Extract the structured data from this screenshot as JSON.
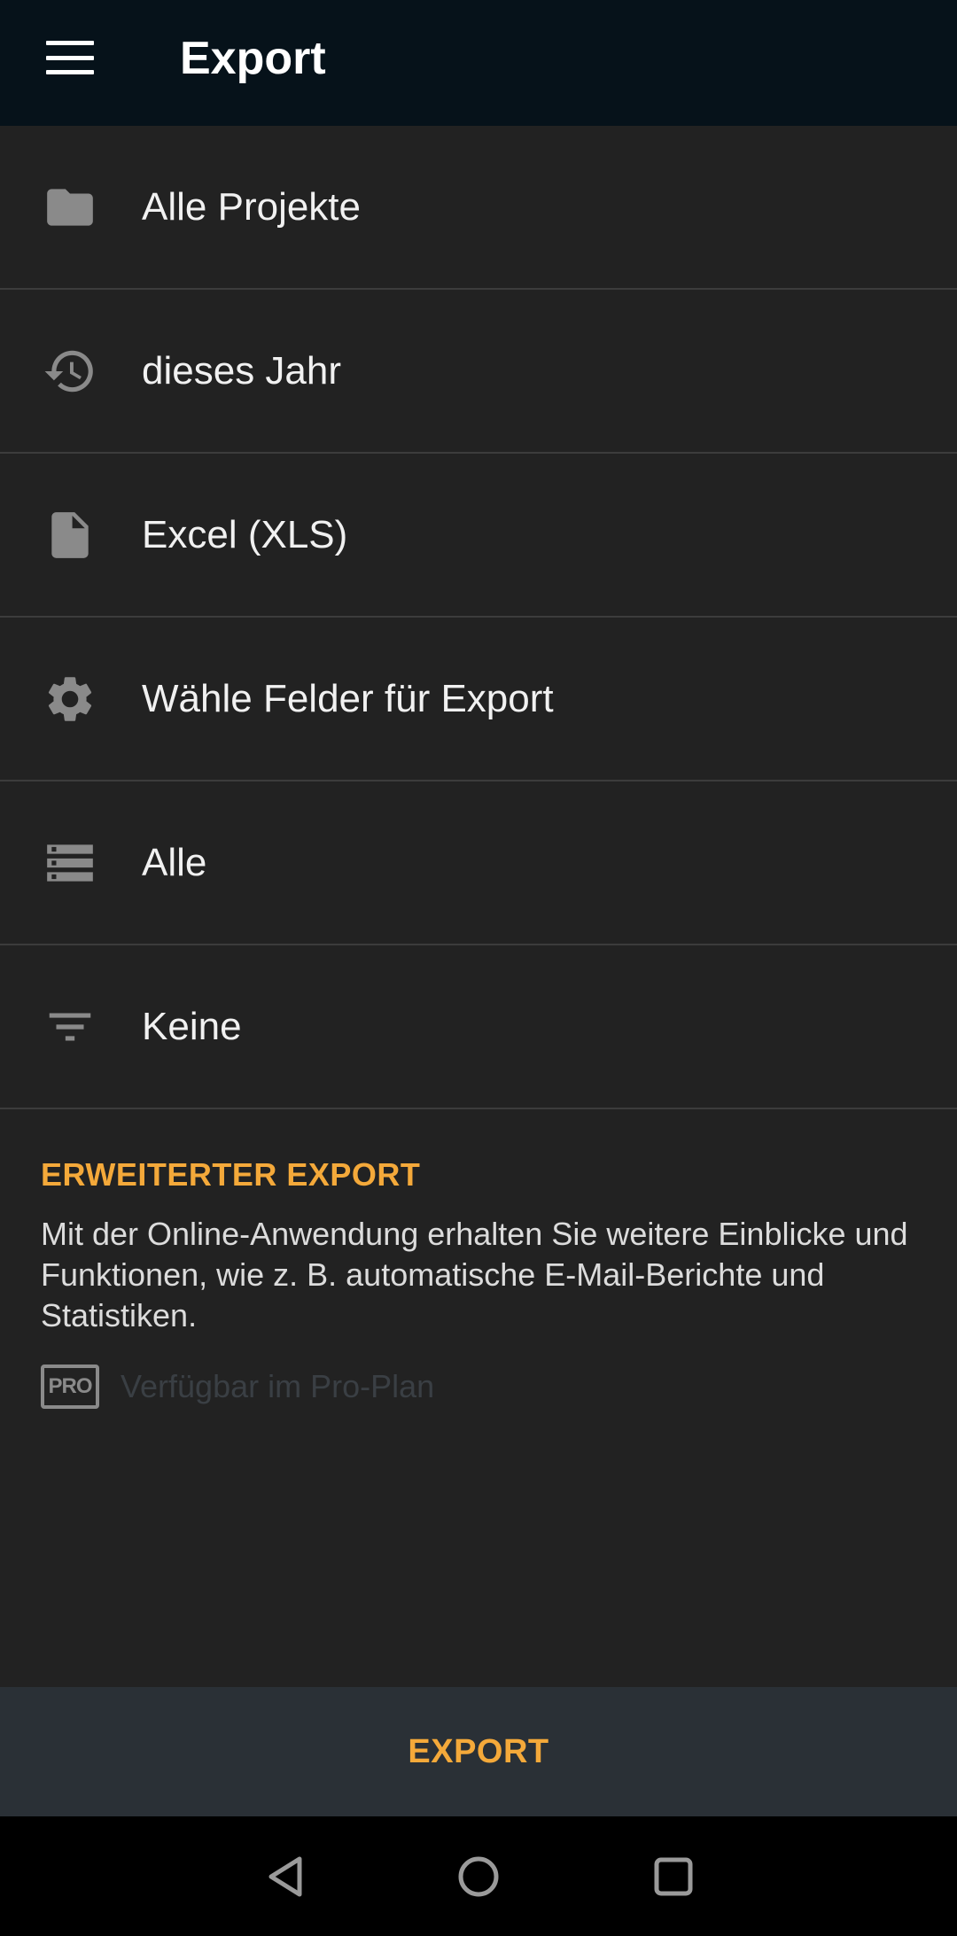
{
  "app_bar": {
    "title": "Export",
    "menu_icon": "hamburger-menu-icon"
  },
  "options": [
    {
      "icon": "folder-icon",
      "label": "Alle Projekte"
    },
    {
      "icon": "history-icon",
      "label": "dieses Jahr"
    },
    {
      "icon": "file-icon",
      "label": "Excel (XLS)"
    },
    {
      "icon": "gear-icon",
      "label": "Wähle Felder für Export"
    },
    {
      "icon": "storage-icon",
      "label": "Alle"
    },
    {
      "icon": "filter-icon",
      "label": "Keine"
    }
  ],
  "extended_export": {
    "title": "ERWEITERTER EXPORT",
    "description": "Mit der Online-Anwendung erhalten Sie weitere Einblicke und Funktionen, wie z. B. automatische E-Mail-Berichte und Statistiken.",
    "pro_badge": "PRO",
    "pro_text": "Verfügbar im Pro-Plan"
  },
  "export_button": {
    "label": "EXPORT"
  },
  "system_nav": {
    "back_icon": "back-triangle-icon",
    "home_icon": "home-circle-icon",
    "recents_icon": "recents-square-icon"
  },
  "colors": {
    "accent": "#f4a93a",
    "app_bar": "#06121a",
    "background": "#222222",
    "export_bar": "#2a3036"
  }
}
